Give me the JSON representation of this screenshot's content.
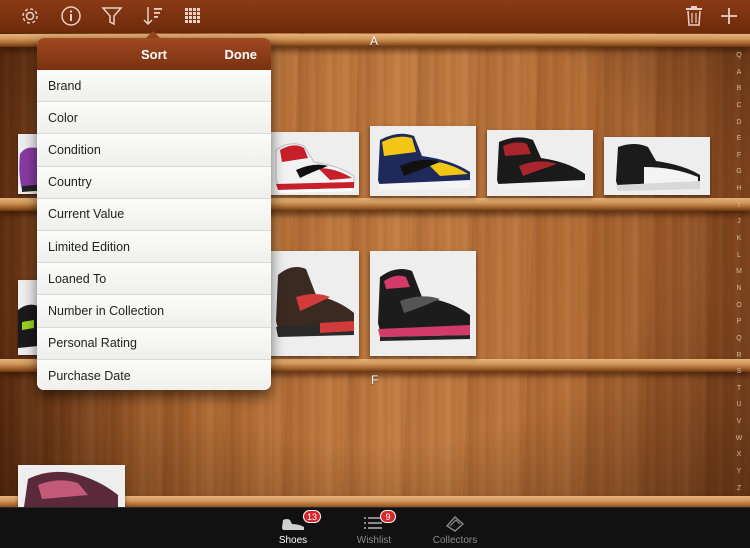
{
  "toolbar": {
    "icons": [
      "gear-icon",
      "info-icon",
      "filter-icon",
      "sort-icon",
      "grid-icon",
      "trash-icon",
      "plus-icon"
    ]
  },
  "shelf_letters": {
    "a": "A",
    "f": "F"
  },
  "index_bar": [
    "Q",
    "A",
    "B",
    "C",
    "D",
    "E",
    "F",
    "G",
    "H",
    "I",
    "J",
    "K",
    "L",
    "M",
    "N",
    "O",
    "P",
    "Q",
    "R",
    "S",
    "T",
    "U",
    "V",
    "W",
    "X",
    "Y",
    "Z"
  ],
  "sort_popover": {
    "title": "Sort",
    "done_label": "Done",
    "items": [
      "Brand",
      "Color",
      "Condition",
      "Country",
      "Current Value",
      "Limited Edition",
      "Loaned To",
      "Number in Collection",
      "Personal Rating",
      "Purchase Date"
    ]
  },
  "tabs": [
    {
      "label": "Shoes",
      "badge": "13",
      "active": true
    },
    {
      "label": "Wishlist",
      "badge": "9",
      "active": false
    },
    {
      "label": "Collectors",
      "badge": "",
      "active": false
    }
  ],
  "colors": {
    "accent": "#8a3a14",
    "badge": "#d8262c",
    "tabbar": "#111111"
  }
}
